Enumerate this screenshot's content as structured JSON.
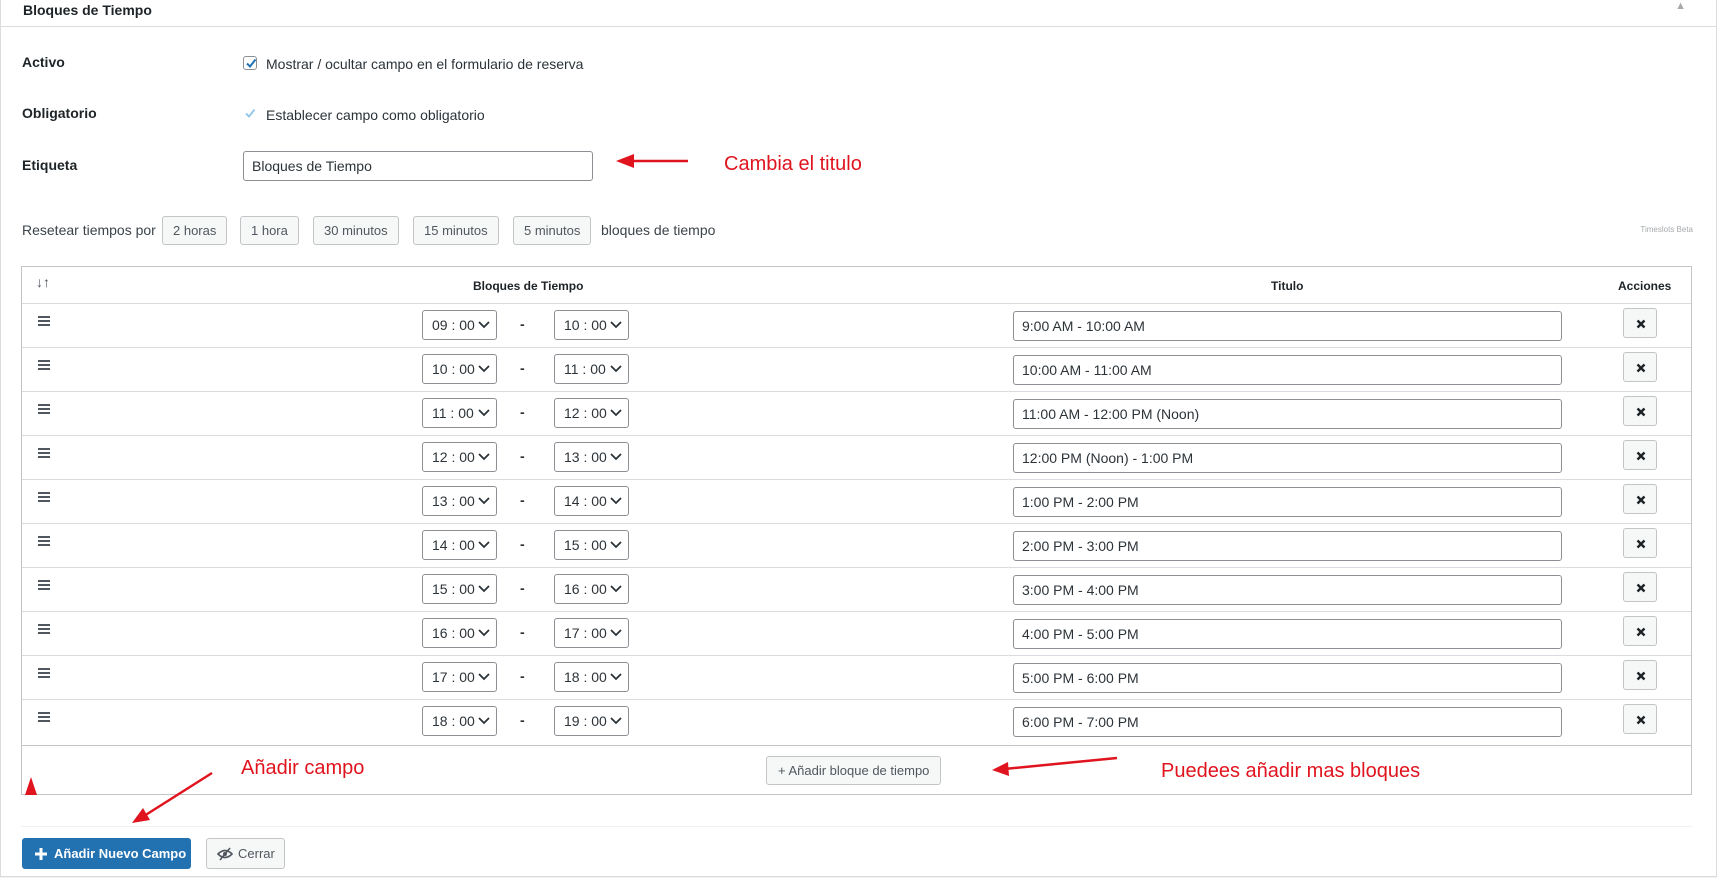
{
  "panel": {
    "title": "Bloques de Tiempo"
  },
  "fields": {
    "active": {
      "label": "Activo",
      "checkbox_text": "Mostrar / ocultar campo en el formulario de reserva",
      "checked": true
    },
    "required": {
      "label": "Obligatorio",
      "checkbox_text": "Establecer campo como obligatorio",
      "checked": true
    },
    "label_field": {
      "label": "Etiqueta",
      "value": "Bloques de Tiempo"
    }
  },
  "reset": {
    "label": "Resetear tiempos por",
    "buttons": [
      "2 horas",
      "1 hora",
      "30 minutos",
      "15 minutos",
      "5 minutos"
    ],
    "suffix": "bloques de tiempo",
    "beta": "Timeslots Beta"
  },
  "table": {
    "headers": {
      "sort": "↓↑",
      "slots": "Bloques de Tiempo",
      "title": "Titulo",
      "actions": "Acciones"
    },
    "rows": [
      {
        "start": "09 : 00",
        "end": "10 : 00",
        "title": "9:00 AM - 10:00 AM"
      },
      {
        "start": "10 : 00",
        "end": "11 : 00",
        "title": "10:00 AM - 11:00 AM"
      },
      {
        "start": "11 : 00",
        "end": "12 : 00",
        "title": "11:00 AM - 12:00 PM (Noon)"
      },
      {
        "start": "12 : 00",
        "end": "13 : 00",
        "title": "12:00 PM (Noon) - 1:00 PM"
      },
      {
        "start": "13 : 00",
        "end": "14 : 00",
        "title": "1:00 PM - 2:00 PM"
      },
      {
        "start": "14 : 00",
        "end": "15 : 00",
        "title": "2:00 PM - 3:00 PM"
      },
      {
        "start": "15 : 00",
        "end": "16 : 00",
        "title": "3:00 PM - 4:00 PM"
      },
      {
        "start": "16 : 00",
        "end": "17 : 00",
        "title": "4:00 PM - 5:00 PM"
      },
      {
        "start": "17 : 00",
        "end": "18 : 00",
        "title": "5:00 PM - 6:00 PM"
      },
      {
        "start": "18 : 00",
        "end": "19 : 00",
        "title": "6:00 PM - 7:00 PM"
      }
    ],
    "separator": "-",
    "add_slot": "+ Añadir bloque de tiempo"
  },
  "actions": {
    "add_field": "Añadir Nuevo Campo",
    "close": "Cerrar"
  },
  "annotations": {
    "title_note": "Cambia el titulo",
    "add_field_note": "Añadir campo",
    "more_blocks_note": "Puedees añadir mas bloques",
    "color": "#e0141e"
  },
  "colors": {
    "primary": "#2271b1",
    "border": "#c3c4c7",
    "checkmark": "#2271b1"
  }
}
